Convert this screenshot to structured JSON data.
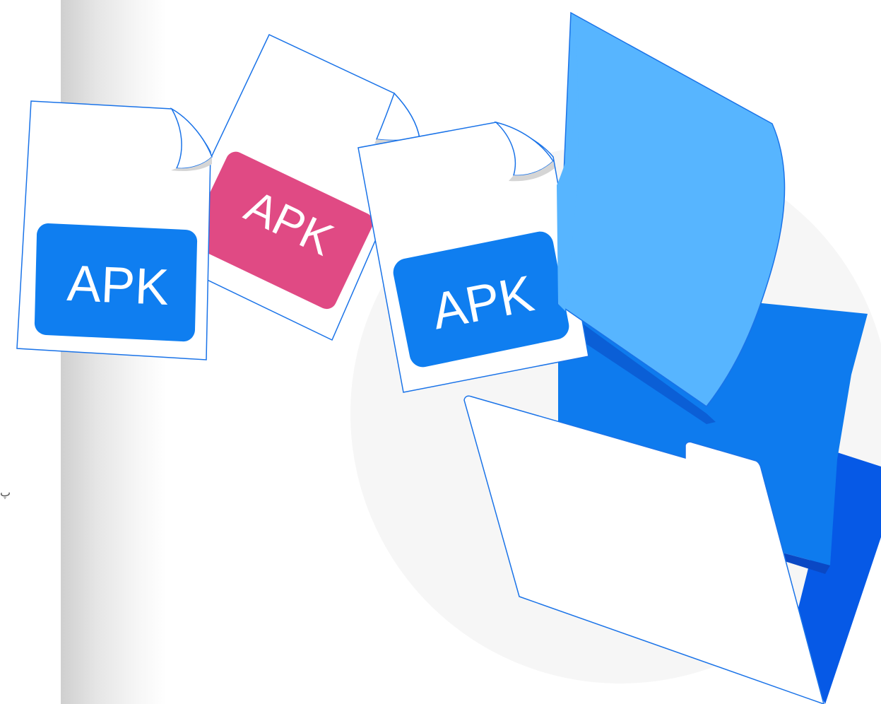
{
  "edge_text": "پ",
  "apk_labels": {
    "left_file": "APK",
    "middle_file": "APK",
    "right_file": "APK"
  },
  "colors": {
    "apk_blue": "#0f7ef0",
    "apk_pink": "#e04a84",
    "folder_light": "#57b5ff",
    "folder_mid": "#0e7bee",
    "folder_dark": "#0659e6",
    "outline": "#1a73e8",
    "circle": "#f6f6f6"
  }
}
